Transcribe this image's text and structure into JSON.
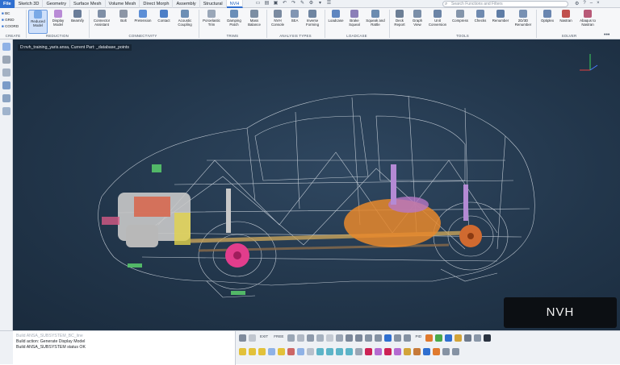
{
  "menubar": {
    "tabs": [
      "File",
      "Sketch 3D",
      "Geometry",
      "Surface Mesh",
      "Volume Mesh",
      "Direct Morph",
      "Assembly",
      "Structural",
      "NVH"
    ],
    "active_tab": "NVH",
    "search_placeholder": "Search Functions and Filters"
  },
  "ribbon": {
    "create": {
      "items": [
        "BC",
        "GRID",
        "COORD"
      ],
      "label": "CREATE"
    },
    "reduction": {
      "buttons": [
        "Reduced Model",
        "Display Model",
        "Beamify"
      ],
      "label": "REDUCTION"
    },
    "connectivity": {
      "buttons": [
        "Connector Assistant",
        "Bolt",
        "Pretension",
        "Contact",
        "Acoustic Coupling"
      ],
      "label": "CONNECTIVITY"
    },
    "trims": {
      "buttons": [
        "Poroelastic Trim",
        "Damping Patch",
        "Mass Balance"
      ],
      "label": "TRIMS"
    },
    "analysis_types": {
      "buttons": [
        "NVH Console",
        "SEA",
        "Inverse Forming"
      ],
      "label": "ANALYSIS TYPES"
    },
    "loadcase": {
      "buttons": [
        "Loadcase",
        "Brake Squeal",
        "Squeak and Rattle"
      ],
      "label": "LOADCASE"
    },
    "tools": {
      "buttons": [
        "Deck Report",
        "Graph View",
        "Unit Conversion",
        "Compress",
        "Checks",
        "Renumber",
        "2D/3D Renumber"
      ],
      "label": "TOOLS"
    },
    "solver": {
      "buttons": [
        "Optiplex",
        "Nastran",
        "Abaqus to Nastran"
      ],
      "label": "SOLVER"
    }
  },
  "viewport": {
    "title": "D:nvh_training_yaris.ansa,  Current Part: _database_points",
    "badge": "NVH"
  },
  "console": {
    "line1": "Build ANSA_SUBSYSTEM_BC_line",
    "line2": "Build action: Generate Display Model",
    "line3": "Build ANSA_SUBSYSTEM status OK"
  },
  "bottom_toolbar": {
    "exit_label": "EXIT",
    "free_label": "FREE",
    "pid_label": "PID"
  }
}
